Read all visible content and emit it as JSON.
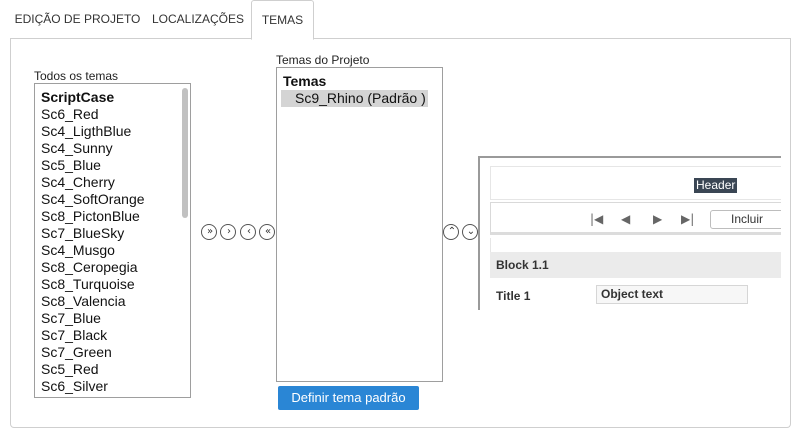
{
  "tabs": [
    {
      "label": "EDIÇÃO DE PROJETO"
    },
    {
      "label": "LOCALIZAÇÕES"
    },
    {
      "label": "TEMAS"
    }
  ],
  "all_themes": {
    "label": "Todos os temas",
    "items": [
      "ScriptCase",
      "Sc6_Red",
      "Sc4_LigthBlue",
      "Sc4_Sunny",
      "Sc5_Blue",
      "Sc4_Cherry",
      "Sc4_SoftOrange",
      "Sc8_PictonBlue",
      "Sc7_BlueSky",
      "Sc4_Musgo",
      "Sc8_Ceropegia",
      "Sc8_Turquoise",
      "Sc8_Valencia",
      "Sc7_Blue",
      "Sc7_Black",
      "Sc7_Green",
      "Sc5_Red",
      "Sc6_Silver"
    ]
  },
  "transfer_buttons": {
    "add_all": "»",
    "add_one": "›",
    "remove_one": "‹",
    "remove_all": "«"
  },
  "order_buttons": {
    "up": "⌃",
    "down": "⌄"
  },
  "project_themes": {
    "label": "Temas do Projeto",
    "items": [
      "Temas",
      "Sc9_Rhino (Padrão )"
    ]
  },
  "set_default_button": "Definir tema padrão",
  "preview": {
    "header": "Header",
    "nav": {
      "first": "|◀",
      "prev": "◀",
      "next": "▶",
      "last": "▶|"
    },
    "incluir": "Incluir",
    "block": "Block 1.1",
    "title": "Title 1",
    "object_text": "Object text"
  }
}
